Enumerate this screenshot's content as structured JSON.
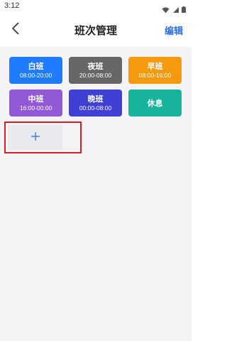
{
  "status_bar": {
    "time": "3:12",
    "icons": [
      "wifi-icon",
      "signal-icon",
      "battery-icon"
    ]
  },
  "header": {
    "back_icon": "chevron-left-icon",
    "title": "班次管理",
    "edit_label": "编辑"
  },
  "shifts": [
    {
      "name": "白班",
      "time": "08:00-20:00",
      "color": "#1f7bff"
    },
    {
      "name": "夜班",
      "time": "20:00-08:00",
      "color": "#666666"
    },
    {
      "name": "早班",
      "time": "08:00-16:00",
      "color": "#f59a0c"
    },
    {
      "name": "中班",
      "time": "16:00-00:00",
      "color": "#9158d8"
    },
    {
      "name": "晚班",
      "time": "00:00-08:00",
      "color": "#4040d6"
    },
    {
      "name": "休息",
      "time": "",
      "color": "#16b49a"
    }
  ],
  "add_button": {
    "icon": "plus-icon",
    "highlight_color": "#d81e26"
  }
}
